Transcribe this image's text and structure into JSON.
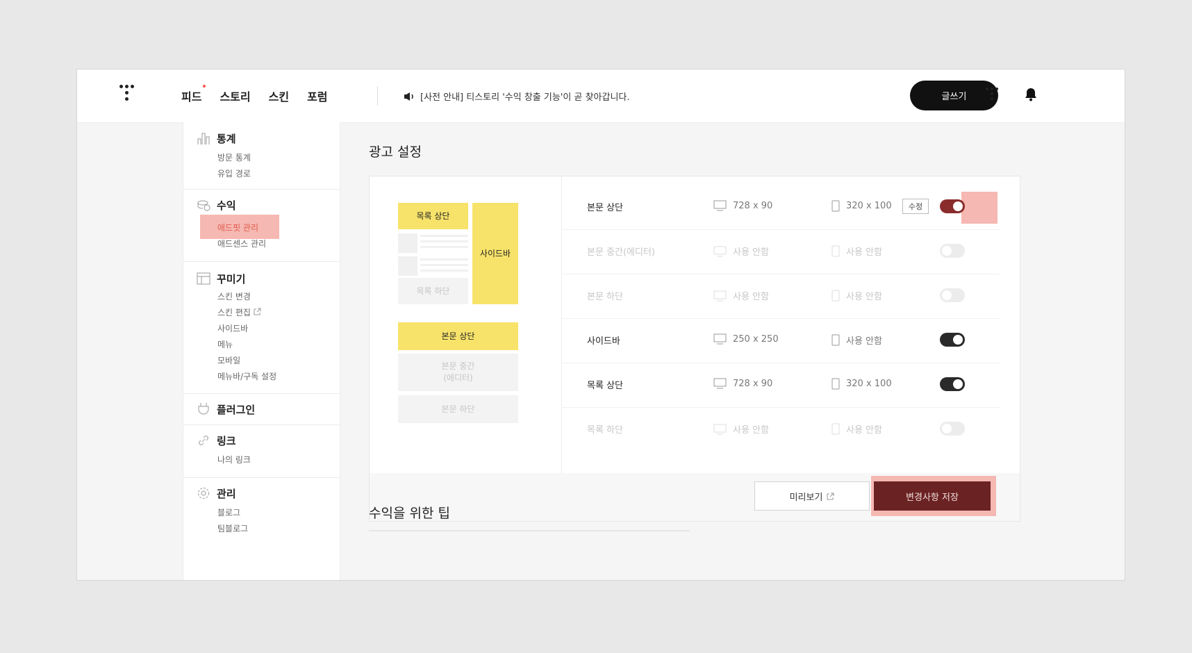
{
  "header": {
    "nav": [
      "피드",
      "스토리",
      "스킨",
      "포럼"
    ],
    "notice": "[사전 안내] 티스토리 '수익 창출 기능'이 곧 찾아갑니다.",
    "write_label": "글쓰기"
  },
  "sidebar": {
    "stats": {
      "title": "통계",
      "items": [
        "방문 통계",
        "유입 경로"
      ]
    },
    "revenue": {
      "title": "수익",
      "items": [
        "애드핏 관리",
        "애드센스 관리"
      ],
      "active_item": "애드핏 관리"
    },
    "decor": {
      "title": "꾸미기",
      "items": [
        "스킨 변경",
        "스킨 편집",
        "사이드바",
        "메뉴",
        "모바일",
        "메뉴바/구독 설정"
      ]
    },
    "plugin": {
      "title": "플러그인"
    },
    "link": {
      "title": "링크",
      "items": [
        "나의 링크"
      ]
    },
    "manage": {
      "title": "관리",
      "items": [
        "블로그",
        "팀블로그"
      ]
    }
  },
  "main": {
    "title": "광고 설정",
    "tips_title": "수익을 위한 팁",
    "diagram": {
      "list_top": "목록 상단",
      "sidebar": "사이드바",
      "list_bottom": "목록 하단",
      "body_top": "본문 상단",
      "body_middle_line1": "본문 중간",
      "body_middle_line2": "(에디터)",
      "body_bottom": "본문 하단"
    },
    "rows": [
      {
        "name": "본문 상단",
        "pc": "728 x 90",
        "mobile": "320 x 100",
        "on": true,
        "edit_label": "수정"
      },
      {
        "name": "본문 중간(에디터)",
        "pc": "사용 안함",
        "mobile": "사용 안함",
        "on": false
      },
      {
        "name": "본문 하단",
        "pc": "사용 안함",
        "mobile": "사용 안함",
        "on": false
      },
      {
        "name": "사이드바",
        "pc": "250 x 250",
        "mobile": "사용 안함",
        "on": true
      },
      {
        "name": "목록 상단",
        "pc": "728 x 90",
        "mobile": "320 x 100",
        "on": true
      },
      {
        "name": "목록 하단",
        "pc": "사용 안함",
        "mobile": "사용 안함",
        "on": false
      }
    ],
    "preview_label": "미리보기",
    "save_label": "변경사항 저장"
  },
  "colors": {
    "highlight": "#f5b8b2",
    "save_button": "#6b2222",
    "ad_slot": "#f7e36a",
    "toggle_on": "#2a2a2a"
  }
}
